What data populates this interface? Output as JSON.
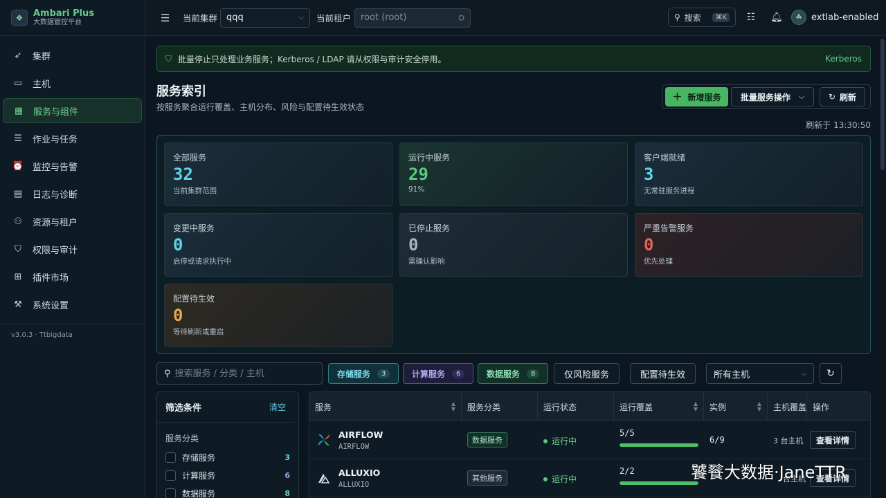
{
  "brand": {
    "title": "Ambari Plus",
    "subtitle": "大数据管控平台"
  },
  "sidebar": {
    "items": [
      {
        "label": "集群",
        "icon": "rocket-icon",
        "active": false
      },
      {
        "label": "主机",
        "icon": "monitor-icon",
        "active": false
      },
      {
        "label": "服务与组件",
        "icon": "grid-icon",
        "active": true
      },
      {
        "label": "作业与任务",
        "icon": "list-icon",
        "active": false
      },
      {
        "label": "监控与告警",
        "icon": "alarm-icon",
        "active": false
      },
      {
        "label": "日志与诊断",
        "icon": "log-file-icon",
        "active": false
      },
      {
        "label": "资源与租户",
        "icon": "users-icon",
        "active": false
      },
      {
        "label": "权限与审计",
        "icon": "shield-check-icon",
        "active": false
      },
      {
        "label": "插件市场",
        "icon": "plugin-icon",
        "active": false
      },
      {
        "label": "系统设置",
        "icon": "wrench-icon",
        "active": false
      }
    ],
    "version": "v3.0.3 · Ttbigdata"
  },
  "topbar": {
    "cluster_label": "当前集群",
    "cluster_value": "qqq",
    "tenant_label": "当前租户",
    "tenant_value": "root (root)",
    "search_label": "搜索",
    "search_shortcut": "⌘K",
    "username": "extlab-enabled"
  },
  "banner": {
    "message": "批量停止只处理业务服务；Kerberos / LDAP 请从权限与审计安全停用。",
    "link": "Kerberos"
  },
  "page": {
    "title": "服务索引",
    "subtitle": "按服务聚合运行覆盖、主机分布、风险与配置待生效状态",
    "add_button": "新增服务",
    "bulk_button": "批量服务操作",
    "refresh_button": "刷新",
    "refresh_time": "刷新于 13:30:50"
  },
  "stats": [
    {
      "label": "全部服务",
      "value": "32",
      "desc": "当前集群范围",
      "color": "#5fd3e8"
    },
    {
      "label": "运行中服务",
      "value": "29",
      "desc": "91%",
      "color": "#5cc97d"
    },
    {
      "label": "客户端就绪",
      "value": "3",
      "desc": "无常驻服务进程",
      "color": "#5fd3e8"
    },
    {
      "label": "变更中服务",
      "value": "0",
      "desc": "启停或请求执行中",
      "color": "#5fd3e8"
    },
    {
      "label": "已停止服务",
      "value": "0",
      "desc": "需确认影响",
      "color": "#a9b3ba"
    },
    {
      "label": "严重告警服务",
      "value": "0",
      "desc": "优先处理",
      "color": "#e0625e"
    },
    {
      "label": "配置待生效",
      "value": "0",
      "desc": "等待刷新或重启",
      "color": "#e6a64a"
    }
  ],
  "filters": {
    "search_placeholder": "搜索服务 / 分类 / 主机",
    "chips": [
      {
        "label": "存储服务",
        "count": "3"
      },
      {
        "label": "计算服务",
        "count": "6"
      },
      {
        "label": "数据服务",
        "count": "8"
      }
    ],
    "risk_only": "仅风险服务",
    "pending_config": "配置待生效",
    "host_select": "所有主机"
  },
  "filter_panel": {
    "title": "筛选条件",
    "clear": "清空",
    "section": "服务分类",
    "options": [
      {
        "label": "存储服务",
        "count": "3"
      },
      {
        "label": "计算服务",
        "count": "6"
      },
      {
        "label": "数据服务",
        "count": "8"
      }
    ]
  },
  "table": {
    "headers": [
      "服务",
      "服务分类",
      "运行状态",
      "运行覆盖",
      "实例",
      "主机覆盖",
      "操作"
    ],
    "rows": [
      {
        "name": "AIRFLOW",
        "code": "AIRFLOW",
        "category": "数据服务",
        "status": "运行中",
        "coverage": "5/5",
        "coverage_ratio": 1.0,
        "instances": "6/9",
        "hosts": "3 台主机",
        "action": "查看详情"
      },
      {
        "name": "ALLUXIO",
        "code": "ALLUXIO",
        "category": "其他服务",
        "status": "运行中",
        "coverage": "2/2",
        "coverage_ratio": 1.0,
        "instances": "",
        "hosts": "台主机",
        "action": "查看详情"
      }
    ]
  },
  "watermark": "饕餮大数据·JaneTTR"
}
